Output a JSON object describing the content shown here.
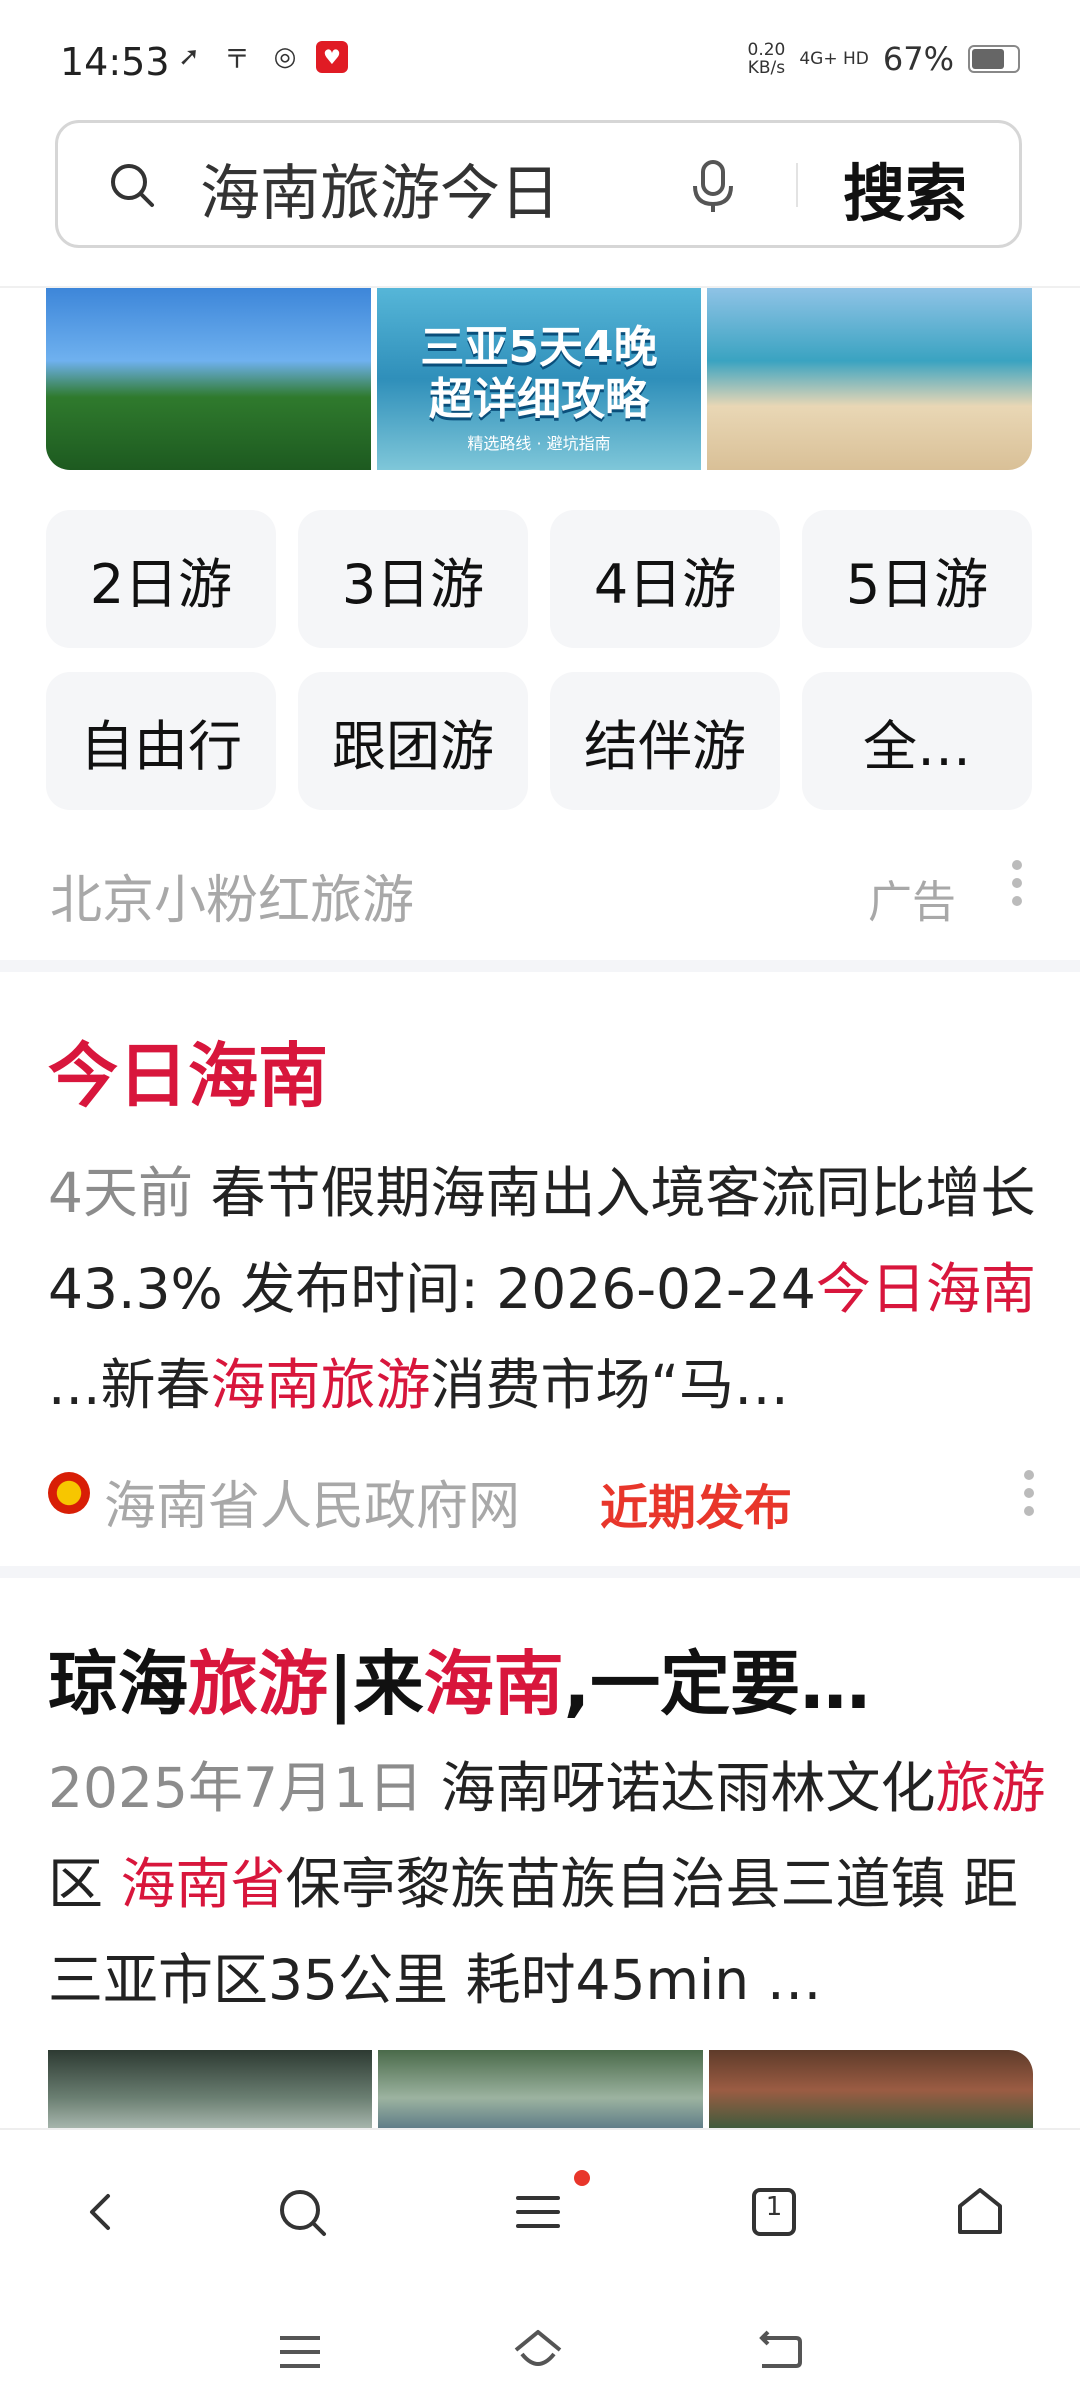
{
  "status_bar": {
    "time": "14:53",
    "net_speed": "0.20",
    "net_speed_unit": "KB/s",
    "network": "4G+ HD",
    "battery": "67%",
    "battery_level": 0.67
  },
  "search": {
    "query": "海南旅游今日",
    "button_label": "搜索"
  },
  "banner": {
    "promo_title_line1": "三亚5天4晚",
    "promo_title_line2": "超详细攻略",
    "promo_subtitle": "精选路线 · 避坑指南"
  },
  "tags": [
    "2日游",
    "3日游",
    "4日游",
    "5日游",
    "自由行",
    "跟团游",
    "结伴游",
    "全…"
  ],
  "ad": {
    "source": "北京小粉红旅游",
    "label": "广告"
  },
  "result1": {
    "title": "今日海南",
    "date": "4天前",
    "text1": " 春节假期海南出入境客流同比增长43.3% 发布时间: 2026-02-24",
    "hl1": "今日海南",
    "text2": " ...新春",
    "hl2": "海南旅游",
    "text3": "消费市场“马…",
    "source": "海南省人民政府网",
    "tag": "近期发布"
  },
  "result2": {
    "title_a": "琼海",
    "title_hl1": "旅游",
    "title_b": "|来",
    "title_hl2": "海南",
    "title_c": ",一定要…",
    "date": "2025年7月1日",
    "text1": " 海南呀诺达雨林文化",
    "hl1": "旅游",
    "text2": "区 ",
    "hl2": "海南省",
    "text3": "保亭黎族苗族自治县三道镇 距三亚市区35公里 耗时45min …"
  },
  "toolbar": {
    "tab_count": "1"
  },
  "colors": {
    "accent_red": "#d8163c",
    "tag_red": "#e8362b",
    "muted_gray": "#a8a8a8"
  }
}
